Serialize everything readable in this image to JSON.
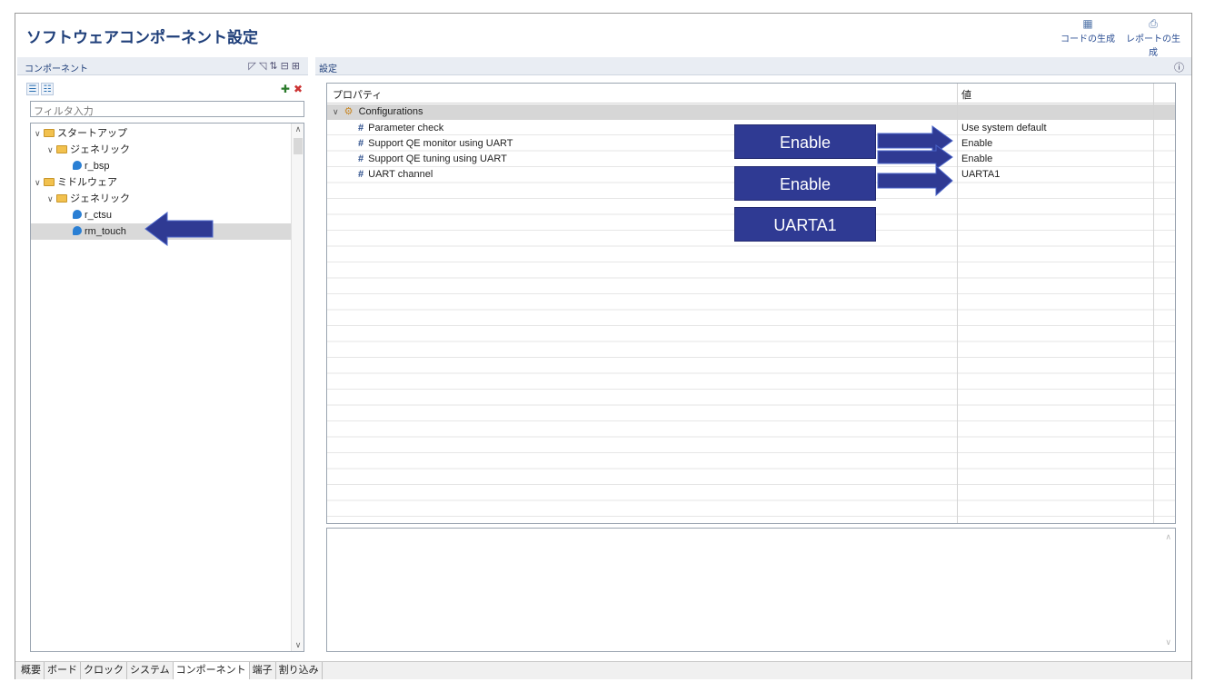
{
  "header": {
    "title": "ソフトウェアコンポーネント設定",
    "generate_code_label": "コードの生成",
    "generate_report_label": "レポートの生成"
  },
  "left_pane": {
    "title": "コンポーネント",
    "filter_placeholder": "フィルタ入力",
    "tree": [
      {
        "label": "スタートアップ",
        "type": "folder",
        "level": 0,
        "expanded": true
      },
      {
        "label": "ジェネリック",
        "type": "folder",
        "level": 1,
        "expanded": true
      },
      {
        "label": "r_bsp",
        "type": "component",
        "level": 2
      },
      {
        "label": "ミドルウェア",
        "type": "folder",
        "level": 0,
        "expanded": true
      },
      {
        "label": "ジェネリック",
        "type": "folder",
        "level": 1,
        "expanded": true
      },
      {
        "label": "r_ctsu",
        "type": "component",
        "level": 2
      },
      {
        "label": "rm_touch",
        "type": "component",
        "level": 2,
        "selected": true
      }
    ]
  },
  "right_pane": {
    "title": "設定",
    "columns": {
      "property": "プロパティ",
      "value": "値"
    },
    "group": "Configurations",
    "rows": [
      {
        "property": "Parameter check",
        "value": "Use system default"
      },
      {
        "property": "Support QE monitor using UART",
        "value": "Enable"
      },
      {
        "property": "Support QE tuning using UART",
        "value": "Enable"
      },
      {
        "property": "UART channel",
        "value": "UARTA1"
      }
    ]
  },
  "annotations": {
    "callouts": [
      "Enable",
      "Enable",
      "UARTA1"
    ],
    "color": "#2f3a93"
  },
  "bottom_tabs": [
    "概要",
    "ボード",
    "クロック",
    "システム",
    "コンポーネント",
    "端子",
    "割り込み"
  ]
}
